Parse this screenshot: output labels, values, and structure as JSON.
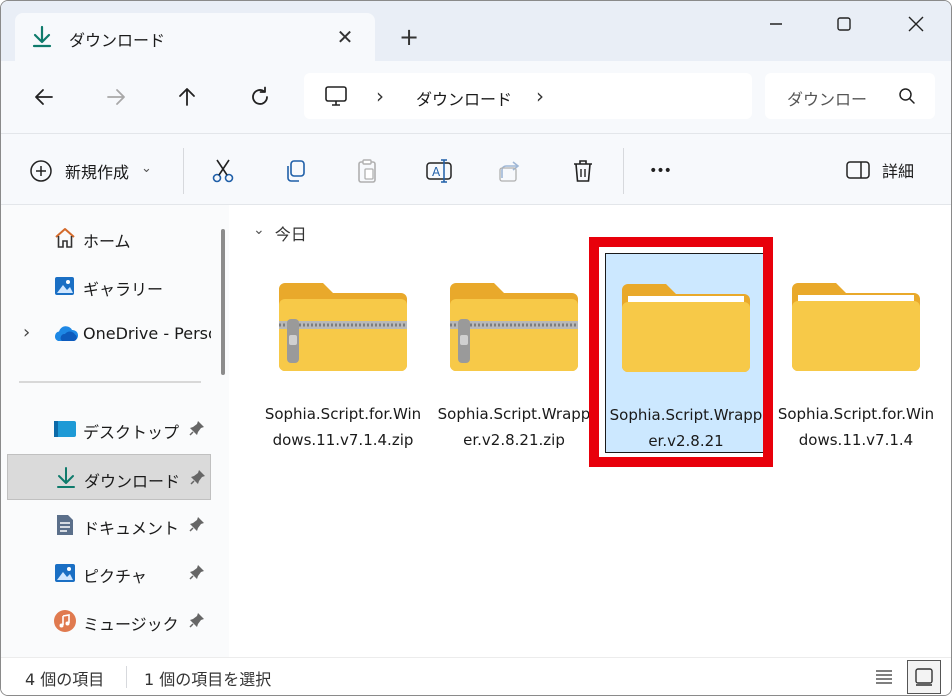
{
  "tab": {
    "title": "ダウンロード",
    "close": "✕",
    "new_tab": "+"
  },
  "address": {
    "sep1": "›",
    "location": "ダウンロード",
    "sep2": "›"
  },
  "search": {
    "placeholder": "ダウンロー"
  },
  "commands": {
    "new_label": "新規作成",
    "new_chevron": "⌄",
    "more": "•••",
    "details_label": "詳細"
  },
  "sidebar": {
    "items": [
      {
        "label": "ホーム"
      },
      {
        "label": "ギャラリー"
      },
      {
        "label": "OneDrive - Perso",
        "chevron": "›"
      },
      {
        "label": "デスクトップ"
      },
      {
        "label": "ダウンロード"
      },
      {
        "label": "ドキュメント"
      },
      {
        "label": "ピクチャ"
      },
      {
        "label": "ミュージック"
      }
    ]
  },
  "content": {
    "group_label": "今日",
    "group_chevron": "⌄",
    "files": [
      {
        "name": "Sophia.Script.for.Windows.11.v7.1.4.zip",
        "type": "zip-folder"
      },
      {
        "name": "Sophia.Script.Wrapper.v2.8.21.zip",
        "type": "zip-folder"
      },
      {
        "name": "Sophia.Script.Wrapper.v2.8.21",
        "type": "folder",
        "selected": true
      },
      {
        "name": "Sophia.Script.for.Windows.11.v7.1.4",
        "type": "folder"
      }
    ]
  },
  "status": {
    "item_count": "4 個の項目",
    "selected_count": "1 個の項目を選択"
  },
  "colors": {
    "accent": "#0f7b6c",
    "highlight": "#e8000b",
    "selection": "#cce8ff",
    "folder": "#f7c948"
  }
}
